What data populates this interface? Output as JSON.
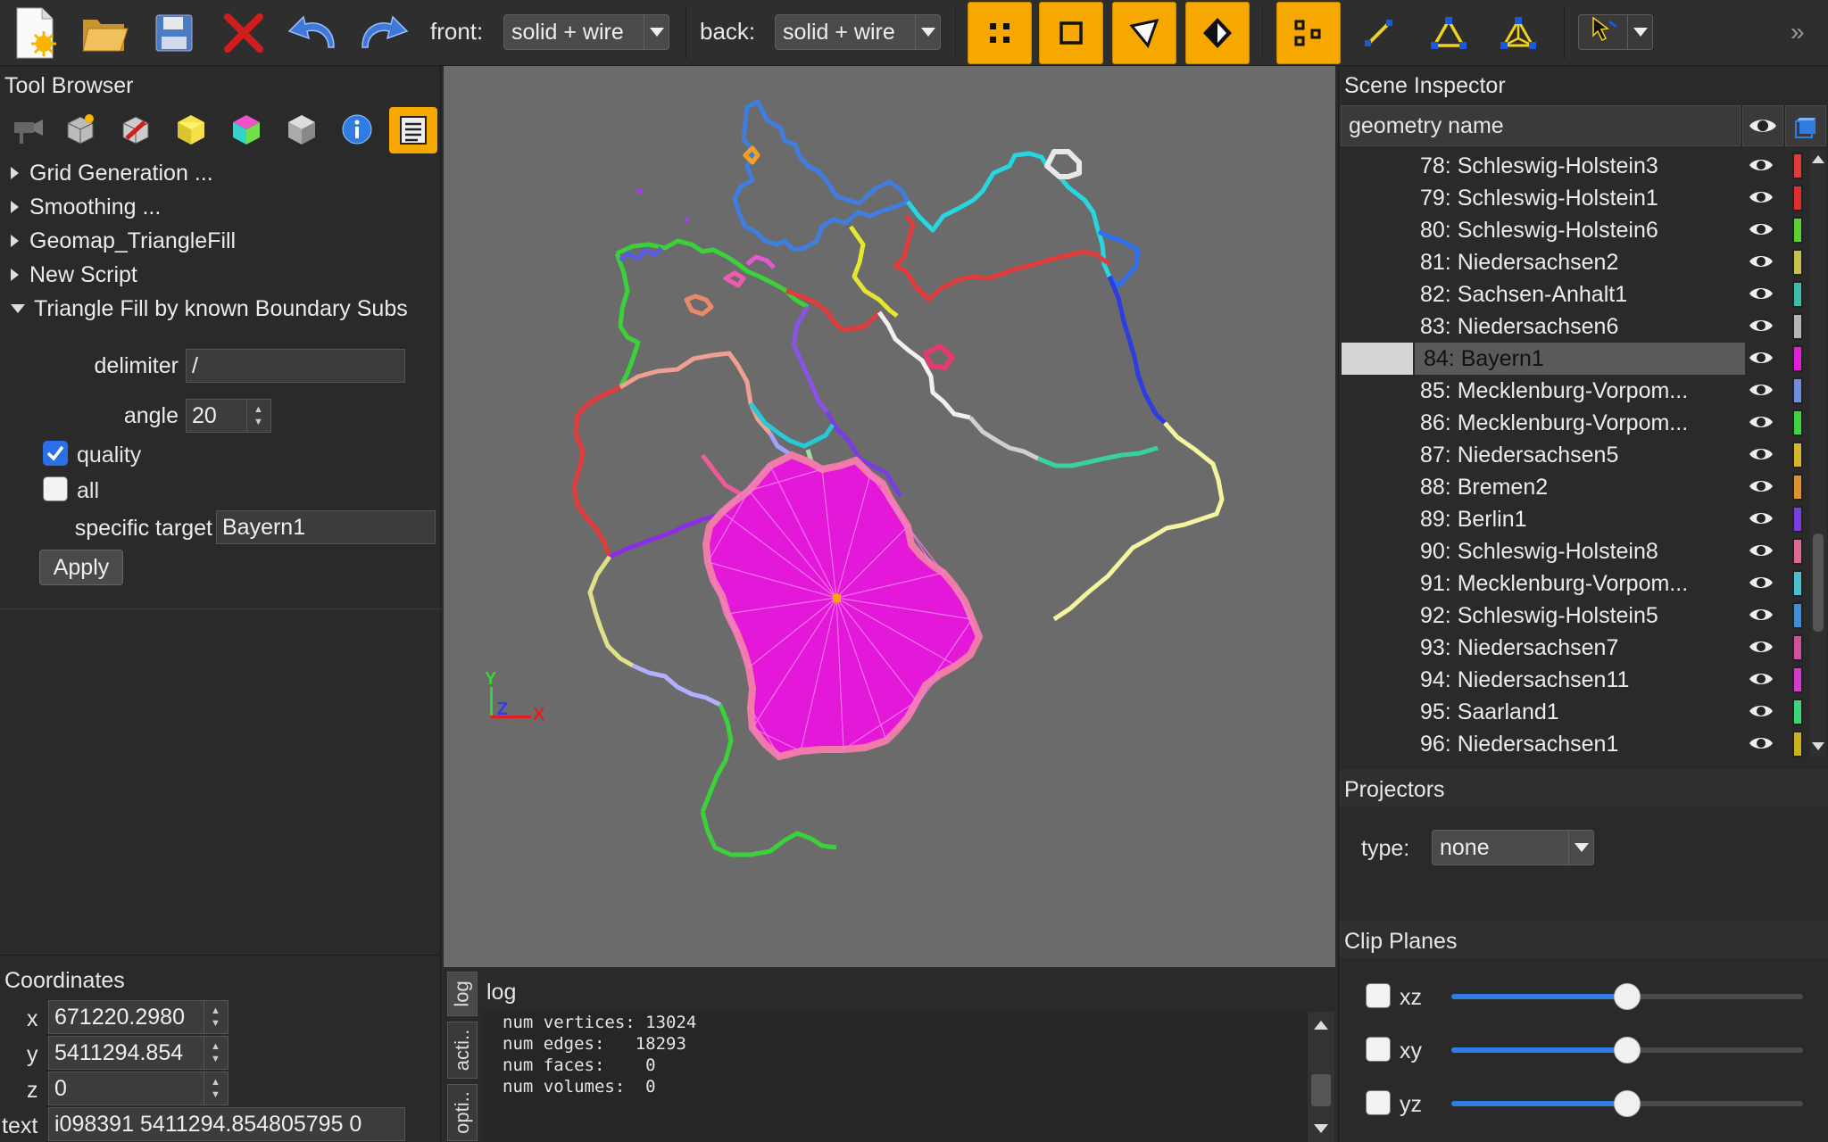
{
  "toolbar": {
    "front_label": "front:",
    "front_value": "solid + wire",
    "back_label": "back:",
    "back_value": "solid + wire",
    "buttons": [
      "new-file-icon",
      "open-folder-icon",
      "save-icon",
      "delete-icon",
      "undo-icon",
      "redo-icon"
    ],
    "mode_buttons": [
      "vertex-mode-icon",
      "edge-mode-icon",
      "face-mode-icon",
      "volume-mode-icon"
    ],
    "more": "»"
  },
  "tool_browser": {
    "title": "Tool Browser",
    "items": [
      {
        "label": "Grid Generation ..."
      },
      {
        "label": "Smoothing ..."
      },
      {
        "label": "Geomap_TriangleFill"
      },
      {
        "label": "New Script"
      },
      {
        "label": "Triangle Fill by known Boundary Subs"
      }
    ],
    "delimiter_label": "delimiter",
    "delimiter_value": "/",
    "angle_label": "angle",
    "angle_value": "20",
    "quality_label": "quality",
    "quality_checked": true,
    "all_label": "all",
    "all_checked": false,
    "target_label": "specific target",
    "target_value": "Bayern1",
    "apply_label": "Apply"
  },
  "coordinates": {
    "title": "Coordinates",
    "x_label": "x",
    "x_value": "671220.2980",
    "y_label": "y",
    "y_value": "5411294.854",
    "z_label": "z",
    "z_value": "0",
    "text_label": "text",
    "text_value": "i098391 5411294.854805795 0"
  },
  "viewport": {
    "axis_x": "X",
    "axis_y": "Y",
    "axis_z": "Z"
  },
  "log": {
    "title": "log",
    "tabs": [
      "log",
      "acti..",
      "opti.."
    ],
    "lines": "num vertices: 13024\nnum edges:   18293\nnum faces:    0\nnum volumes:  0"
  },
  "scene_inspector": {
    "title": "Scene Inspector",
    "column_header": "geometry name",
    "rows": [
      {
        "name": "78: Schleswig-Holstein3",
        "color": "#e03a3a"
      },
      {
        "name": "79: Schleswig-Holstein1",
        "color": "#e02e2e"
      },
      {
        "name": "80: Schleswig-Holstein6",
        "color": "#59d12e"
      },
      {
        "name": "81: Niedersachsen2",
        "color": "#c9c24a"
      },
      {
        "name": "82: Sachsen-Anhalt1",
        "color": "#3bbfa9"
      },
      {
        "name": "83: Niedersachsen6",
        "color": "#b5b5b5"
      },
      {
        "name": "84: Bayern1",
        "color": "#e31ed8",
        "selected": true
      },
      {
        "name": "85: Mecklenburg-Vorpom...",
        "color": "#6f8de0"
      },
      {
        "name": "86: Mecklenburg-Vorpom...",
        "color": "#3ed43e"
      },
      {
        "name": "87: Niedersachsen5",
        "color": "#d9b52a"
      },
      {
        "name": "88: Bremen2",
        "color": "#e0902c"
      },
      {
        "name": "89: Berlin1",
        "color": "#7a3ee0"
      },
      {
        "name": "90: Schleswig-Holstein8",
        "color": "#e06a8f"
      },
      {
        "name": "91: Mecklenburg-Vorpom...",
        "color": "#4abfd0"
      },
      {
        "name": "92: Schleswig-Holstein5",
        "color": "#3f8fd8"
      },
      {
        "name": "93: Niedersachsen7",
        "color": "#d04fa0"
      },
      {
        "name": "94: Niedersachsen11",
        "color": "#d23ad0"
      },
      {
        "name": "95: Saarland1",
        "color": "#39d67a"
      },
      {
        "name": "96: Niedersachsen1",
        "color": "#c9b21e"
      }
    ]
  },
  "projectors": {
    "title": "Projectors",
    "type_label": "type:",
    "type_value": "none"
  },
  "clip_planes": {
    "title": "Clip Planes",
    "planes": [
      {
        "label": "xz",
        "value": 0.5
      },
      {
        "label": "xy",
        "value": 0.5
      },
      {
        "label": "yz",
        "value": 0.5
      }
    ]
  }
}
